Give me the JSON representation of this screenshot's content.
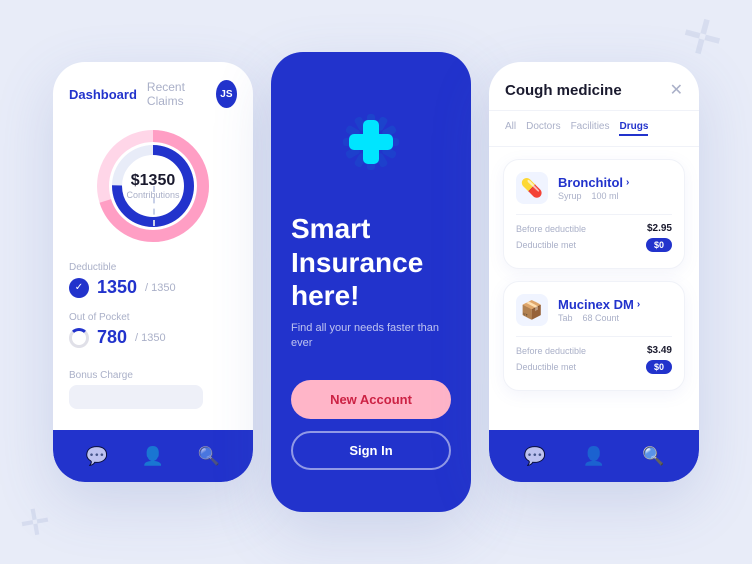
{
  "background": {
    "color": "#e8ecf8"
  },
  "phone1": {
    "tabs": [
      {
        "label": "Dashboard",
        "active": true
      },
      {
        "label": "Recent Claims",
        "active": false
      }
    ],
    "avatar": "JS",
    "donut": {
      "amount": "$1350",
      "label": "Contributions"
    },
    "stats": [
      {
        "label": "Deductible",
        "main": "1350",
        "sub": "/ 1350",
        "icon_type": "check"
      },
      {
        "label": "Out of Pocket",
        "main": "780",
        "sub": "/ 1350",
        "icon_type": "ring"
      }
    ],
    "bonus_label": "Bonus Charge",
    "nav_icons": [
      "💬",
      "👤",
      "🔍"
    ]
  },
  "phone2": {
    "title_line1": "Smart",
    "title_line2": "Insurance",
    "title_line3": "here!",
    "subtitle": "Find all your needs faster than ever",
    "btn_new_account": "New Account",
    "btn_sign_in": "Sign In"
  },
  "phone3": {
    "title": "Cough medicine",
    "filter_tabs": [
      "All",
      "Doctors",
      "Facilities",
      "Drugs"
    ],
    "active_filter": "Drugs",
    "drugs": [
      {
        "name": "Bronchitol",
        "icon": "💊",
        "meta1": "Syrup",
        "meta2": "100 ml",
        "price_before": "$2.95",
        "price_deductible": "$0"
      },
      {
        "name": "Mucinex DM",
        "icon": "📦",
        "meta1": "Tab",
        "meta2": "68 Count",
        "price_before": "$3.49",
        "price_deductible": "$0"
      }
    ],
    "label_before": "Before deductible",
    "label_met": "Deductible met",
    "nav_icons": [
      "💬",
      "👤",
      "🔍"
    ]
  }
}
